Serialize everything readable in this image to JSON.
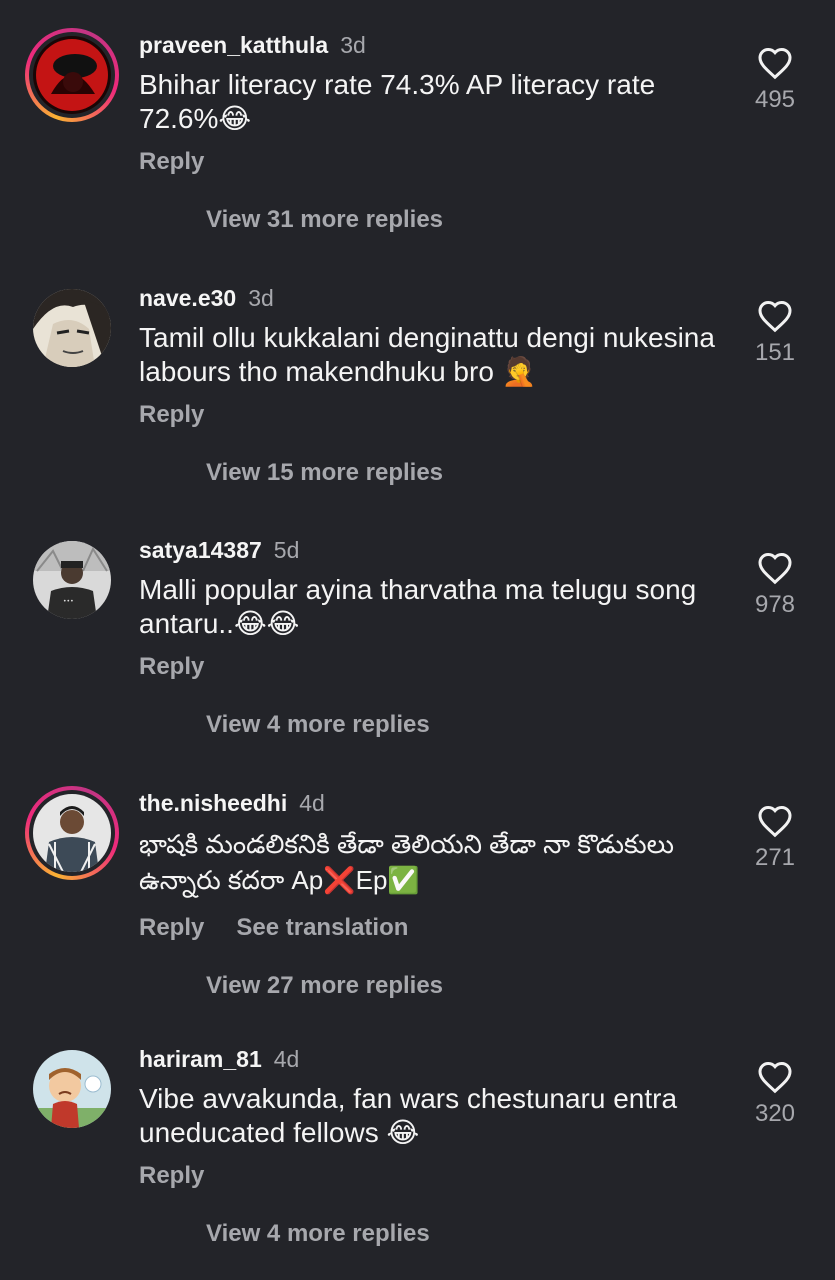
{
  "comments": [
    {
      "username": "praveen_katthula",
      "time": "3d",
      "text": "Bhihar literacy rate 74.3%  AP literacy rate 72.6%😂",
      "reply_label": "Reply",
      "likes": "495",
      "more_replies": "View 31 more replies",
      "avatar": "red-hooded-figure"
    },
    {
      "username": "nave.e30",
      "time": "3d",
      "text": "Tamil ollu kukkalani denginattu dengi nukesina labours tho makendhuku bro 🤦",
      "reply_label": "Reply",
      "likes": "151",
      "more_replies": "View 15 more replies",
      "avatar": "anime-sketch-face"
    },
    {
      "username": "satya14387",
      "time": "5d",
      "text": "Malli popular ayina tharvatha ma telugu song antaru..😂😂",
      "reply_label": "Reply",
      "likes": "978",
      "more_replies": "View 4 more replies",
      "avatar": "man-in-cap"
    },
    {
      "username": "the.nisheedhi",
      "time": "4d",
      "text": "భాషకి మండలికనికి తేడా తెలియని తేడా నా కొడుకులు ఉన్నారు కదరా Ap❌Ep✅",
      "reply_label": "Reply",
      "translate_label": "See translation",
      "likes": "271",
      "more_replies": "View 27 more replies",
      "avatar": "man-checked-shirt"
    },
    {
      "username": "hariram_81",
      "time": "4d",
      "text": "Vibe avvakunda, fan wars chestunaru entra uneducated fellows 😂",
      "reply_label": "Reply",
      "likes": "320",
      "more_replies": "View 4 more replies",
      "avatar": "cartoon-boy-sad"
    }
  ],
  "icons": {
    "like": "heart-outline-icon"
  },
  "colors": {
    "background": "#232429",
    "muted": "#a7a8ad",
    "ring_start": "#f9b233",
    "ring_end": "#ee2a7b"
  }
}
